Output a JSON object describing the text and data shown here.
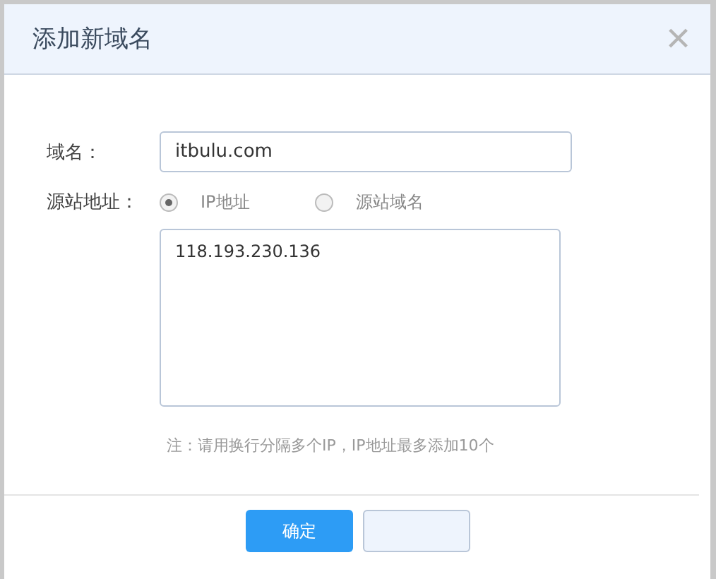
{
  "dialog": {
    "title": "添加新域名",
    "close": "×"
  },
  "domain": {
    "label": "域名：",
    "value": "itbulu.com"
  },
  "origin": {
    "label": "源站地址：",
    "options": [
      {
        "label": "IP地址",
        "selected": true
      },
      {
        "label": "源站域名",
        "selected": false
      }
    ],
    "value": "118.193.230.136"
  },
  "note": "注：请用换行分隔多个IP，IP地址最多添加10个",
  "buttons": [
    {
      "label": "确定",
      "kind": "primary"
    },
    {
      "kind": "secondary"
    }
  ]
}
